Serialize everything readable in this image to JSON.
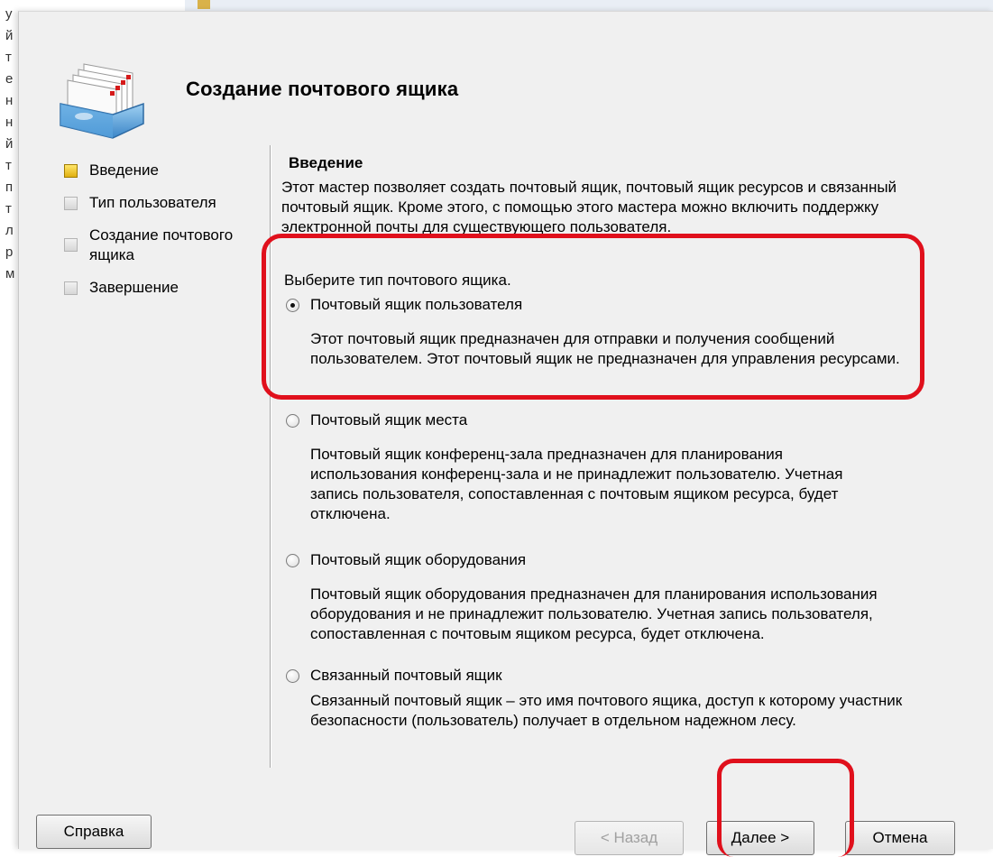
{
  "background": {
    "list_letters": [
      "у",
      "й",
      "т",
      "е",
      "н",
      "н",
      "й",
      "т",
      "п",
      "т",
      "л",
      "р",
      "м"
    ]
  },
  "dialog": {
    "title": "Создание почтового ящика",
    "steps": [
      {
        "label": "Введение",
        "active": true
      },
      {
        "label": "Тип пользователя",
        "active": false
      },
      {
        "label": "Создание почтового ящика",
        "active": false
      },
      {
        "label": "Завершение",
        "active": false
      }
    ],
    "section_title": "Введение",
    "intro": "Этот мастер позволяет создать почтовый ящик, почтовый ящик ресурсов и связанный почтовый ящик. Кроме этого, с помощью этого мастера можно включить поддержку электронной почты для существующего пользователя.",
    "choose_label": "Выберите тип почтового ящика.",
    "options": [
      {
        "label": "Почтовый ящик пользователя",
        "checked": true,
        "description": "Этот почтовый ящик предназначен для отправки и получения сообщений пользователем. Этот почтовый ящик не предназначен для управления ресурсами."
      },
      {
        "label": "Почтовый ящик места",
        "checked": false,
        "description": "Почтовый ящик конференц-зала предназначен для планирования использования конференц-зала и не принадлежит пользователю. Учетная запись пользователя, сопоставленная с почтовым ящиком ресурса, будет отключена."
      },
      {
        "label": "Почтовый ящик оборудования",
        "checked": false,
        "description": "Почтовый ящик оборудования предназначен для планирования использования оборудования и не принадлежит пользователю. Учетная запись пользователя, сопоставленная с почтовым ящиком ресурса, будет отключена."
      },
      {
        "label": "Связанный почтовый ящик",
        "checked": false,
        "description": "Связанный почтовый ящик – это имя почтового ящика, доступ к которому участник безопасности (пользователь) получает в отдельном надежном лесу."
      }
    ],
    "buttons": {
      "help": "Справка",
      "back": "< Назад",
      "next": "Далее >",
      "cancel": "Отмена"
    }
  },
  "annotation_color": "#e0101c",
  "icons": {
    "header": "mailbox-icon"
  }
}
